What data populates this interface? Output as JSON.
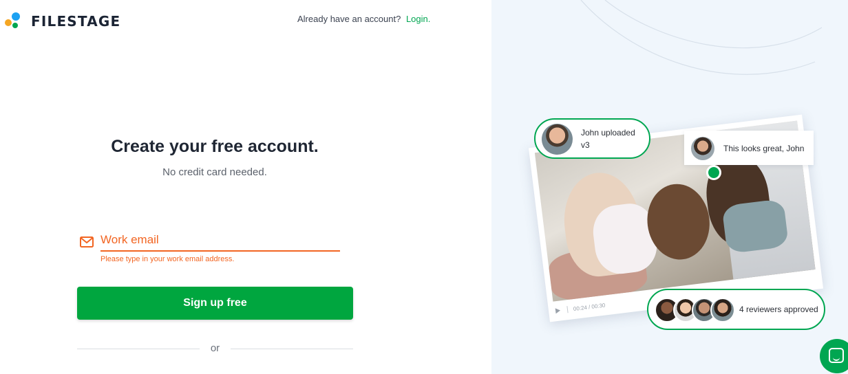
{
  "brand": {
    "name": "FILESTAGE"
  },
  "header": {
    "account_prompt": "Already have an account?",
    "login_link": "Login."
  },
  "form": {
    "title": "Create your free account.",
    "subtitle": "No credit card needed.",
    "email": {
      "placeholder": "Work email",
      "value": ""
    },
    "error_text": "Please type in your work email address.",
    "submit_label": "Sign up free",
    "divider_text": "or"
  },
  "preview": {
    "upload_bubble": {
      "line1": "John uploaded",
      "line2": "v3"
    },
    "comment": "This looks great, John",
    "player_time": "00:24 / 00:30",
    "approval_text": "4 reviewers approved"
  },
  "icons": [
    "mail-icon",
    "play-icon",
    "check-icon",
    "chat-icon"
  ],
  "colors": {
    "accent": "#00a651",
    "error": "#f26522",
    "panel_bg": "#f0f6fc",
    "text_dark": "#1f2633"
  }
}
